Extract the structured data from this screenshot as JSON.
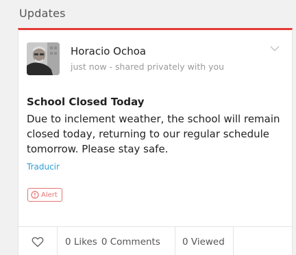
{
  "section": {
    "title": "Updates"
  },
  "post": {
    "author": "Horacio Ochoa",
    "meta": "just now - shared privately with you",
    "title": "School Closed Today",
    "body": "Due to inclement weather, the school will remain closed today, returning to our regular schedule tomorrow. Please stay safe.",
    "translate_label": "Traducir",
    "tag_label": "Alert"
  },
  "actions": {
    "likes": "0 Likes",
    "comments": "0 Comments",
    "viewed": "0 Viewed"
  },
  "colors": {
    "accent": "#e53935",
    "link": "#2f9ed4",
    "alert": "#e57373"
  }
}
